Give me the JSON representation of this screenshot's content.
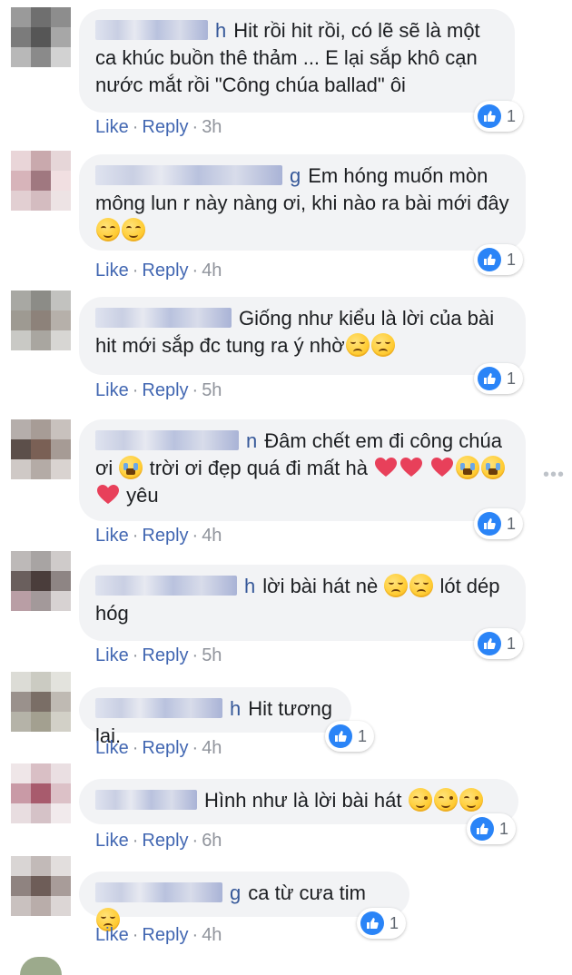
{
  "comments": [
    {
      "name_tail": "h",
      "text": "Hit rồi hit rồi, có lẽ sẽ là một ca khúc buồn thê thảm ... E lại sắp khô cạn nước mắt rồi \"Công chúa ballad\" ôi",
      "like_label": "Like",
      "reply_label": "Reply",
      "time": "3h",
      "reaction_count": "1"
    },
    {
      "name_tail": "g",
      "text": "Em hóng muốn mòn mông lun r này nàng ơi, khi nào ra bài mới đây",
      "emojis_after": [
        "smile",
        "smile"
      ],
      "like_label": "Like",
      "reply_label": "Reply",
      "time": "4h",
      "reaction_count": "1"
    },
    {
      "name_tail": "",
      "text": "Giống như kiểu là lời của bài hit mới sắp đc tung ra ý nhờ",
      "emojis_after": [
        "relieved",
        "relieved"
      ],
      "like_label": "Like",
      "reply_label": "Reply",
      "time": "5h",
      "reaction_count": "1"
    },
    {
      "name_tail": "n",
      "text_1": "Đâm chết em đi công chúa ơi",
      "text_2": "trời ơi đẹp quá đi mất hà",
      "text_3": "yêu",
      "like_label": "Like",
      "reply_label": "Reply",
      "time": "4h",
      "reaction_count": "1"
    },
    {
      "name_tail": "h",
      "text_1": "lời bài hát nè",
      "text_2": "lót dép hóg",
      "like_label": "Like",
      "reply_label": "Reply",
      "time": "5h",
      "reaction_count": "1"
    },
    {
      "name_tail": "h",
      "text": "Hit tương lai.",
      "like_label": "Like",
      "reply_label": "Reply",
      "time": "4h",
      "reaction_count": "1"
    },
    {
      "name_tail": "",
      "text": "Hình như là lời bài hát",
      "like_label": "Like",
      "reply_label": "Reply",
      "time": "6h",
      "reaction_count": "1"
    },
    {
      "name_tail": "g",
      "text": "ca từ cưa tim",
      "like_label": "Like",
      "reply_label": "Reply",
      "time": "4h",
      "reaction_count": "1"
    }
  ],
  "colors": {
    "bubble": "#f2f3f5",
    "link": "#4267b2",
    "meta": "#90949c",
    "like_badge": "#2a84f7",
    "heart": "#e8405a"
  },
  "icons": {
    "reaction": "like-thumb-icon",
    "more": "more-options-icon"
  }
}
